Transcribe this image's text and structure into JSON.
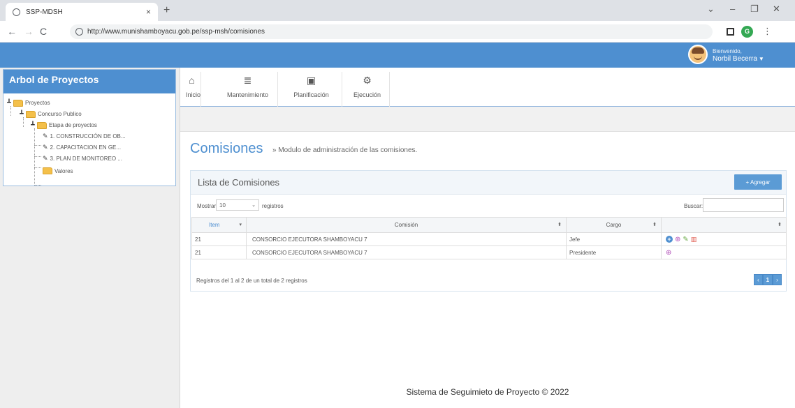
{
  "browser": {
    "tab_title": "SSP-MDSH",
    "tab_close": "×",
    "new_tab": "+",
    "url": "http://www.munishamboyacu.gob.pe/ssp-msh/comisiones",
    "profile_initial": "G",
    "win_min": "–",
    "win_max": "❐",
    "win_close": "✕",
    "win_down": "⌄"
  },
  "header": {
    "welcome_small": "Bienvenido,",
    "user_name": "Norbil Becerra"
  },
  "sidebar": {
    "title": "Arbol de Proyectos",
    "tree": {
      "root": "Proyectos",
      "level1": "Concurso Publico",
      "level2": "Etapa de proyectos",
      "items": [
        "1. CONSTRUCCIÓN DE OB...",
        "2. CAPACITACION EN GE...",
        "3. PLAN DE MONITOREO ..."
      ],
      "values": "Valores"
    }
  },
  "nav": {
    "items": [
      {
        "label": "Inicio",
        "icon": "home-icon"
      },
      {
        "label": "Mantenimiento",
        "icon": "database-icon"
      },
      {
        "label": "Planificación",
        "icon": "briefcase-icon"
      },
      {
        "label": "Ejecución",
        "icon": "gears-icon"
      }
    ]
  },
  "page": {
    "title": "Comisiones",
    "subtitle": "» Modulo de administración de las comisiones."
  },
  "widget": {
    "title": "Lista de Comisiones",
    "add_button": "+ Agregar",
    "show_label": "Mostrar",
    "show_value": "10",
    "records_label": "registros",
    "search_label": "Buscar:",
    "search_value": "",
    "columns": [
      "Item",
      "Comisión",
      "Cargo",
      ""
    ],
    "rows": [
      {
        "item": "21",
        "comision": "CONSORCIO EJECUTORA SHAMBOYACU 7",
        "cargo": "Jefe"
      },
      {
        "item": "21",
        "comision": "CONSORCIO EJECUTORA SHAMBOYACU 7",
        "cargo": "Presidente"
      }
    ],
    "info": "Registros del 1 al 2 de un total de 2 registros",
    "pager": {
      "prev": "‹",
      "current": "1",
      "next": "›"
    }
  },
  "footer": "Sistema de Seguimieto de Proyecto © 2022",
  "colors": {
    "brand_blue": "#4e8fd0",
    "button_blue": "#5b9bd5"
  }
}
